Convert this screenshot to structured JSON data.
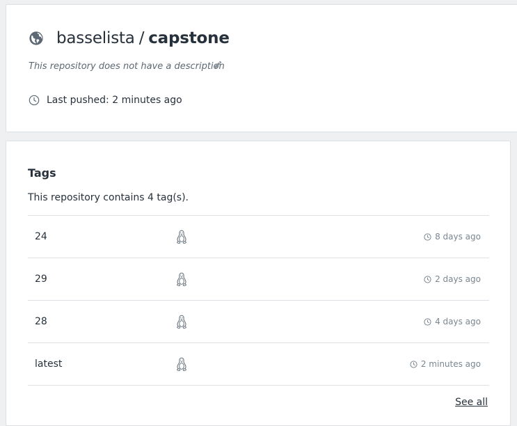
{
  "repo": {
    "owner": "basselista",
    "separator": "/",
    "name": "capstone",
    "description": "This repository does not have a description",
    "last_pushed": "Last pushed: 2 minutes ago"
  },
  "tags_section": {
    "title": "Tags",
    "summary": "This repository contains 4 tag(s).",
    "tags": [
      {
        "name": "24",
        "time": "8 days ago"
      },
      {
        "name": "29",
        "time": "2 days ago"
      },
      {
        "name": "28",
        "time": "4 days ago"
      },
      {
        "name": "latest",
        "time": "2 minutes ago"
      }
    ],
    "see_all_label": "See all"
  },
  "icons": {
    "visibility": "globe-icon",
    "edit": "pencil-icon",
    "time": "clock-icon",
    "platform": "linux-tux-icon"
  },
  "colors": {
    "text": "#27313b",
    "muted": "#7a8690",
    "border": "#dde1e5",
    "background": "#eef0f2"
  }
}
